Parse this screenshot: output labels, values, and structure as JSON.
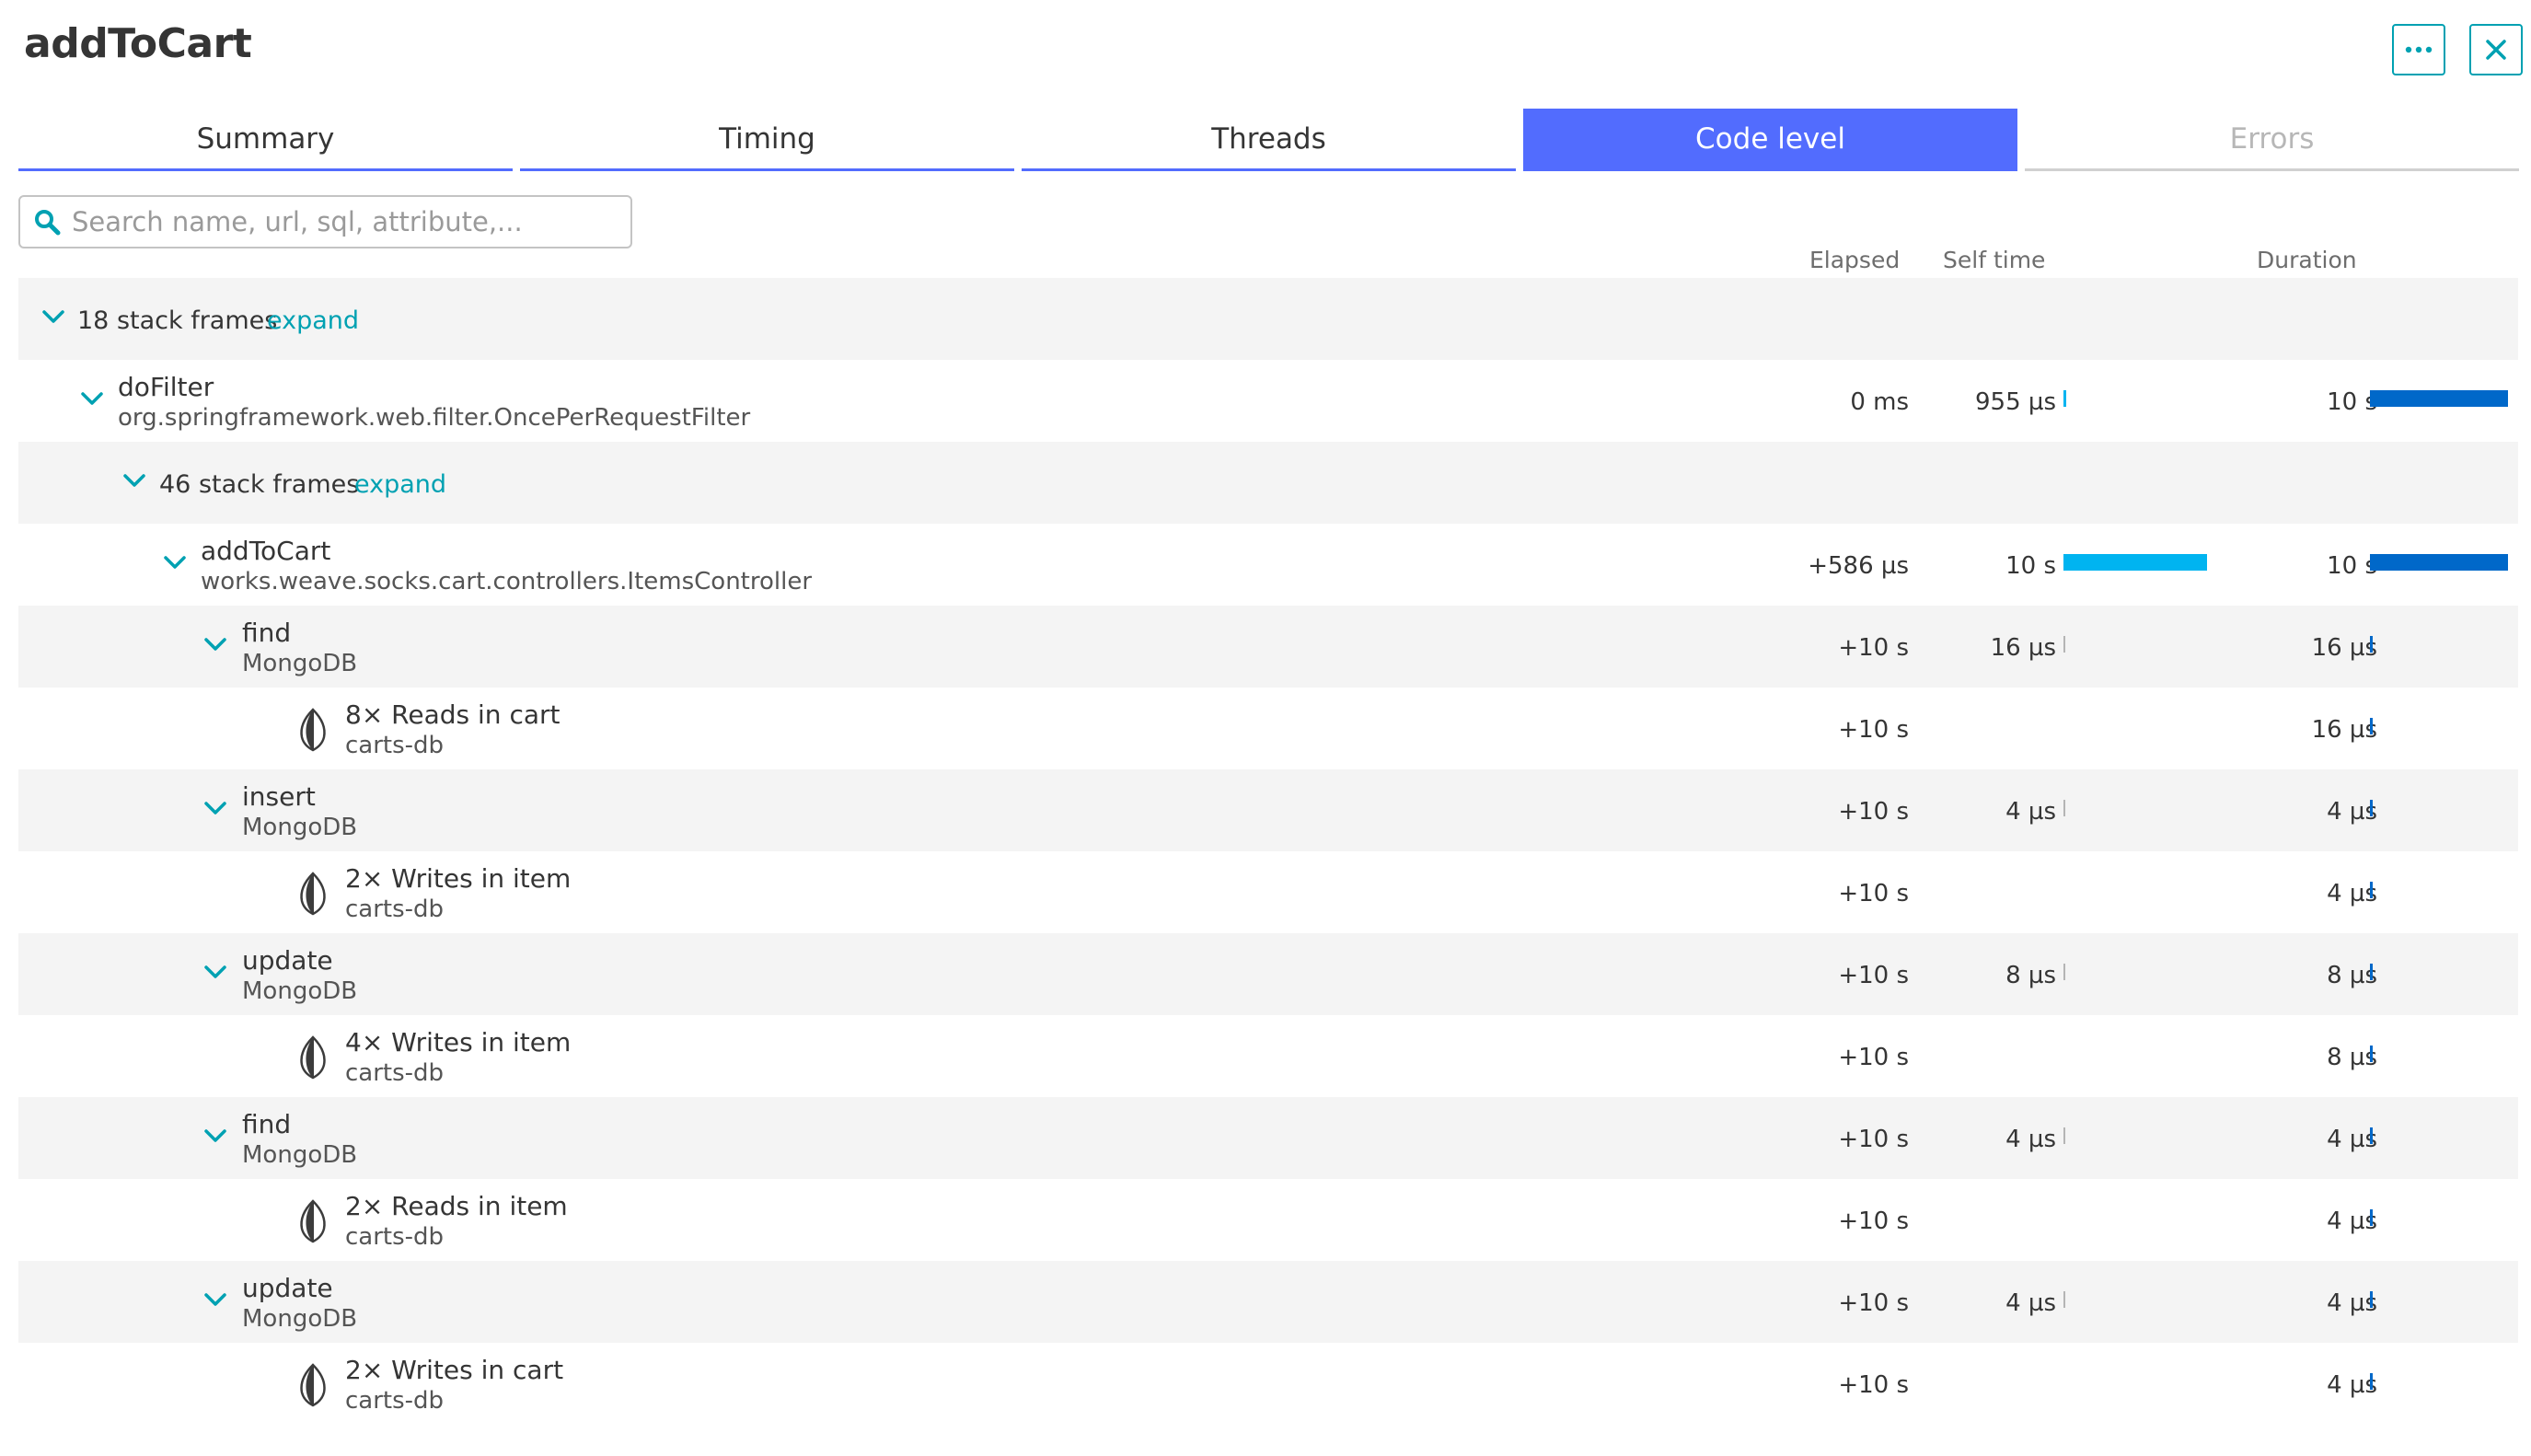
{
  "title": "addToCart",
  "header_buttons": {
    "more": "⋯",
    "close": "✕"
  },
  "tabs": [
    {
      "label": "Summary"
    },
    {
      "label": "Timing"
    },
    {
      "label": "Threads"
    },
    {
      "label": "Code level"
    },
    {
      "label": "Errors"
    }
  ],
  "active_tab": "Code level",
  "search": {
    "placeholder": "Search name, url, sql, attribute,...",
    "value": ""
  },
  "columns": {
    "elapsed": "Elapsed",
    "self_time": "Self time",
    "duration": "Duration"
  },
  "colors": {
    "accent": "#526cfe",
    "link": "#00a1b2",
    "self_bar": "#00b4f0",
    "duration_bar": "#0068c9"
  },
  "rows": [
    {
      "kind": "group",
      "label": "18 stack frames",
      "action": "expand"
    },
    {
      "kind": "method",
      "name": "doFilter",
      "sub": "org.springframework.web.filter.OncePerRequestFilter",
      "elapsed": "0 ms",
      "self_time": "955 µs",
      "duration": "10 s",
      "self_fraction": 0.0001,
      "duration_fraction": 1.0
    },
    {
      "kind": "group",
      "label": "46 stack frames",
      "action": "expand"
    },
    {
      "kind": "method",
      "name": "addToCart",
      "sub": "works.weave.socks.cart.controllers.ItemsController",
      "elapsed": "+586 µs",
      "self_time": "10 s",
      "duration": "10 s",
      "self_fraction": 1.0,
      "duration_fraction": 1.0
    },
    {
      "kind": "method",
      "name": "find",
      "sub": "MongoDB",
      "elapsed": "+10 s",
      "self_time": "16 µs",
      "duration": "16 µs"
    },
    {
      "kind": "db",
      "name": "8× Reads in cart",
      "sub": "carts-db",
      "elapsed": "+10 s",
      "duration": "16 µs"
    },
    {
      "kind": "method",
      "name": "insert",
      "sub": "MongoDB",
      "elapsed": "+10 s",
      "self_time": "4 µs",
      "duration": "4 µs"
    },
    {
      "kind": "db",
      "name": "2× Writes in item",
      "sub": "carts-db",
      "elapsed": "+10 s",
      "duration": "4 µs"
    },
    {
      "kind": "method",
      "name": "update",
      "sub": "MongoDB",
      "elapsed": "+10 s",
      "self_time": "8 µs",
      "duration": "8 µs"
    },
    {
      "kind": "db",
      "name": "4× Writes in item",
      "sub": "carts-db",
      "elapsed": "+10 s",
      "duration": "8 µs"
    },
    {
      "kind": "method",
      "name": "find",
      "sub": "MongoDB",
      "elapsed": "+10 s",
      "self_time": "4 µs",
      "duration": "4 µs"
    },
    {
      "kind": "db",
      "name": "2× Reads in item",
      "sub": "carts-db",
      "elapsed": "+10 s",
      "duration": "4 µs"
    },
    {
      "kind": "method",
      "name": "update",
      "sub": "MongoDB",
      "elapsed": "+10 s",
      "self_time": "4 µs",
      "duration": "4 µs"
    },
    {
      "kind": "db",
      "name": "2× Writes in cart",
      "sub": "carts-db",
      "elapsed": "+10 s",
      "duration": "4 µs"
    }
  ]
}
